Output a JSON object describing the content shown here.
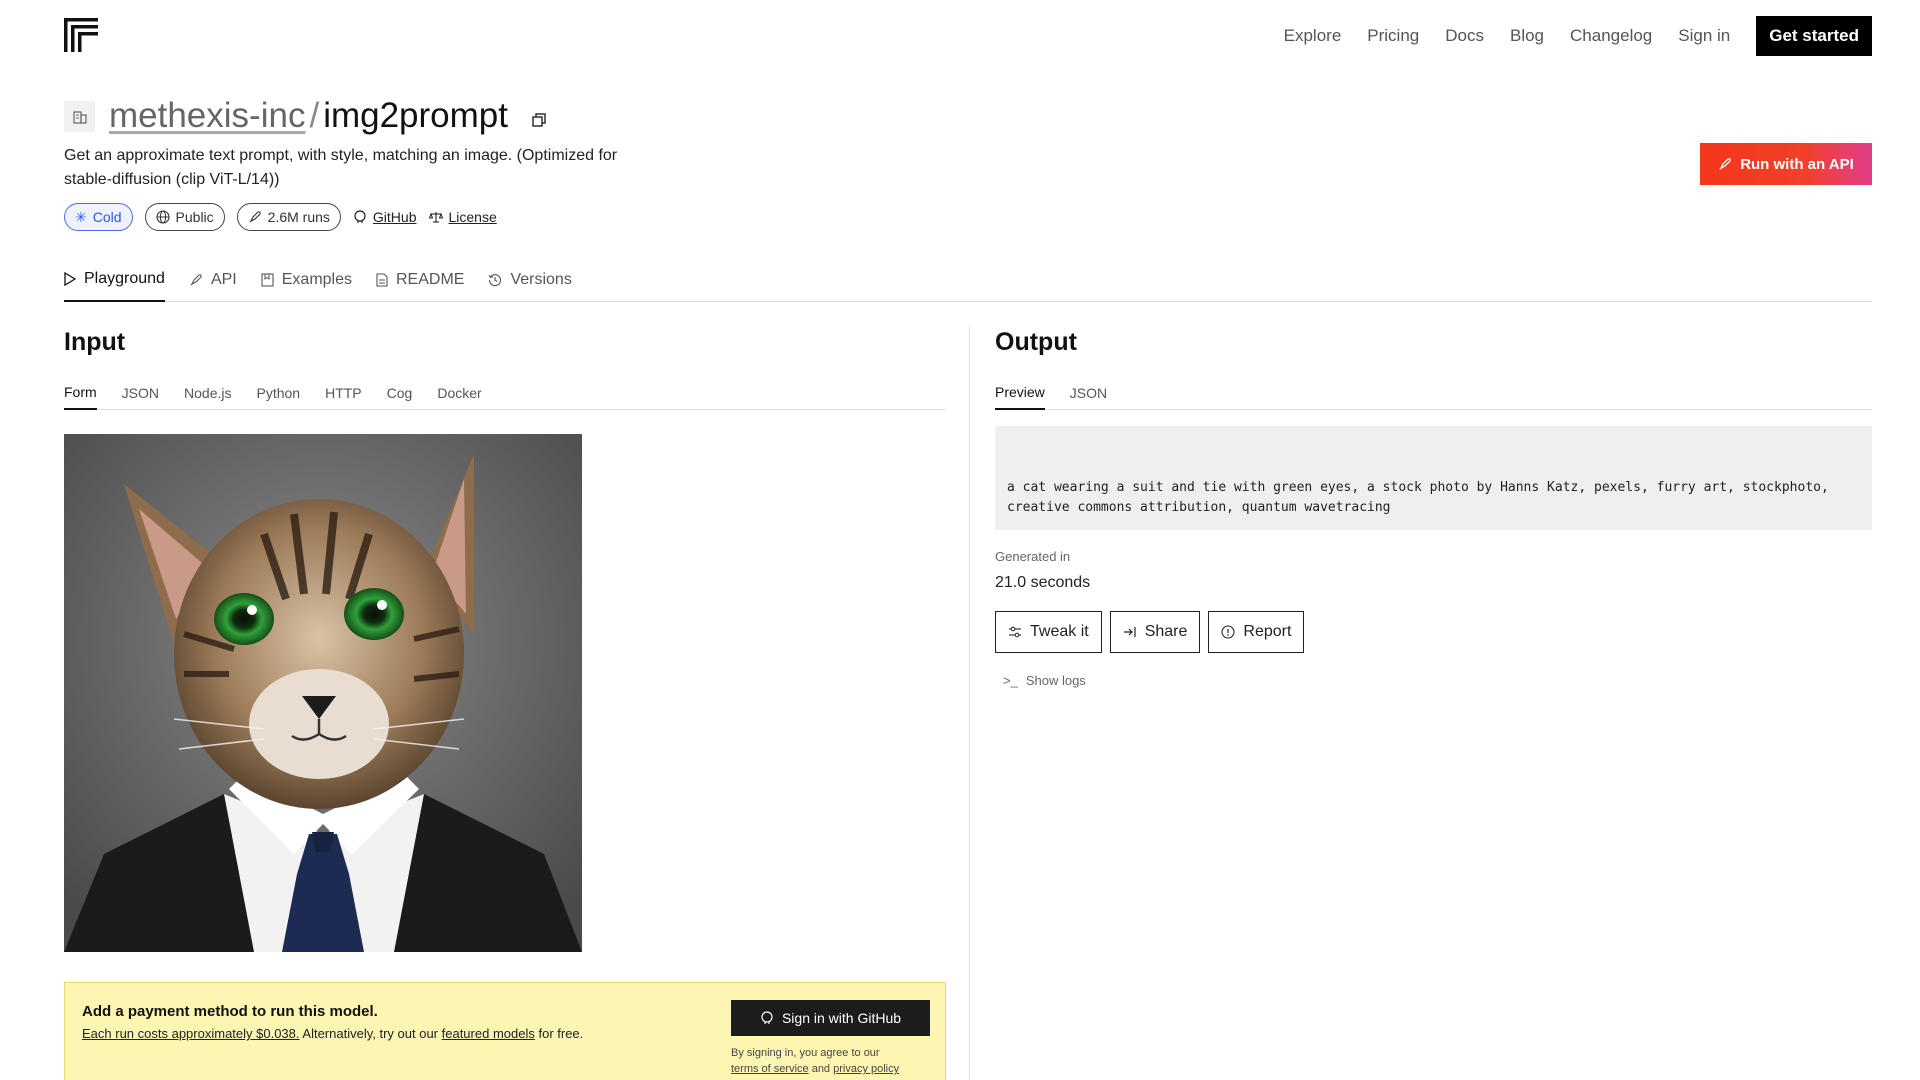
{
  "nav": {
    "items": [
      "Explore",
      "Pricing",
      "Docs",
      "Blog",
      "Changelog",
      "Sign in"
    ],
    "cta": "Get started"
  },
  "model": {
    "org": "methexis-inc",
    "separator": "/",
    "name": "img2prompt",
    "description": "Get an approximate text prompt, with style, matching an image. (Optimized for stable-diffusion (clip ViT-L/14))"
  },
  "badges": {
    "status": "Cold",
    "visibility": "Public",
    "runs": "2.6M runs",
    "github": "GitHub",
    "license": "License"
  },
  "run_api": "Run with an API",
  "tabs": [
    "Playground",
    "API",
    "Examples",
    "README",
    "Versions"
  ],
  "input": {
    "heading": "Input",
    "subtabs": [
      "Form",
      "JSON",
      "Node.js",
      "Python",
      "HTTP",
      "Cog",
      "Docker"
    ]
  },
  "payment": {
    "title": "Add a payment method to run this model.",
    "cost_link": "Each run costs approximately $0.038.",
    "text_mid": " Alternatively, try out our ",
    "featured_link": "featured models",
    "text_end": " for free.",
    "button": "Sign in with GitHub",
    "legal_1": "By signing in, you agree to our",
    "terms": "terms of service",
    "and": " and ",
    "privacy": "privacy policy"
  },
  "output": {
    "heading": "Output",
    "subtabs": [
      "Preview",
      "JSON"
    ],
    "text": "a cat wearing a suit and tie with green eyes, a stock photo by Hanns Katz, pexels, furry art, stockphoto, creative commons attribution, quantum wavetracing",
    "generated_label": "Generated in",
    "generated_value": "21.0 seconds",
    "actions": [
      "Tweak it",
      "Share",
      "Report"
    ],
    "show_logs": "Show logs"
  },
  "colors": {
    "accent_red": "#f4361b",
    "accent_pink": "#e23e8a",
    "cold_blue": "#2f56d6",
    "banner_yellow": "#fdf6b3"
  }
}
